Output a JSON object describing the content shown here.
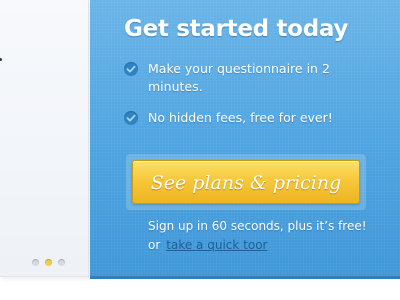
{
  "panel": {
    "title": "Get started today",
    "features": [
      {
        "text": "Make your questionnaire in 2 minutes.",
        "icon": "check-icon"
      },
      {
        "text": "No hidden fees, free for ever!",
        "icon": "check-icon"
      }
    ],
    "cta_label": "See plans & pricing",
    "signup_text": "Sign up  in 60 seconds, plus it’s free!",
    "or_text": "or",
    "tour_link": "take a quick toor"
  },
  "slider": {
    "dot_count": 3,
    "active_index": 1
  },
  "colors": {
    "panel_blue": "#4ca3e0",
    "cta_yellow": "#f6c83a",
    "link_blue": "#1f5f94",
    "active_dot": "#f0cf4c"
  }
}
